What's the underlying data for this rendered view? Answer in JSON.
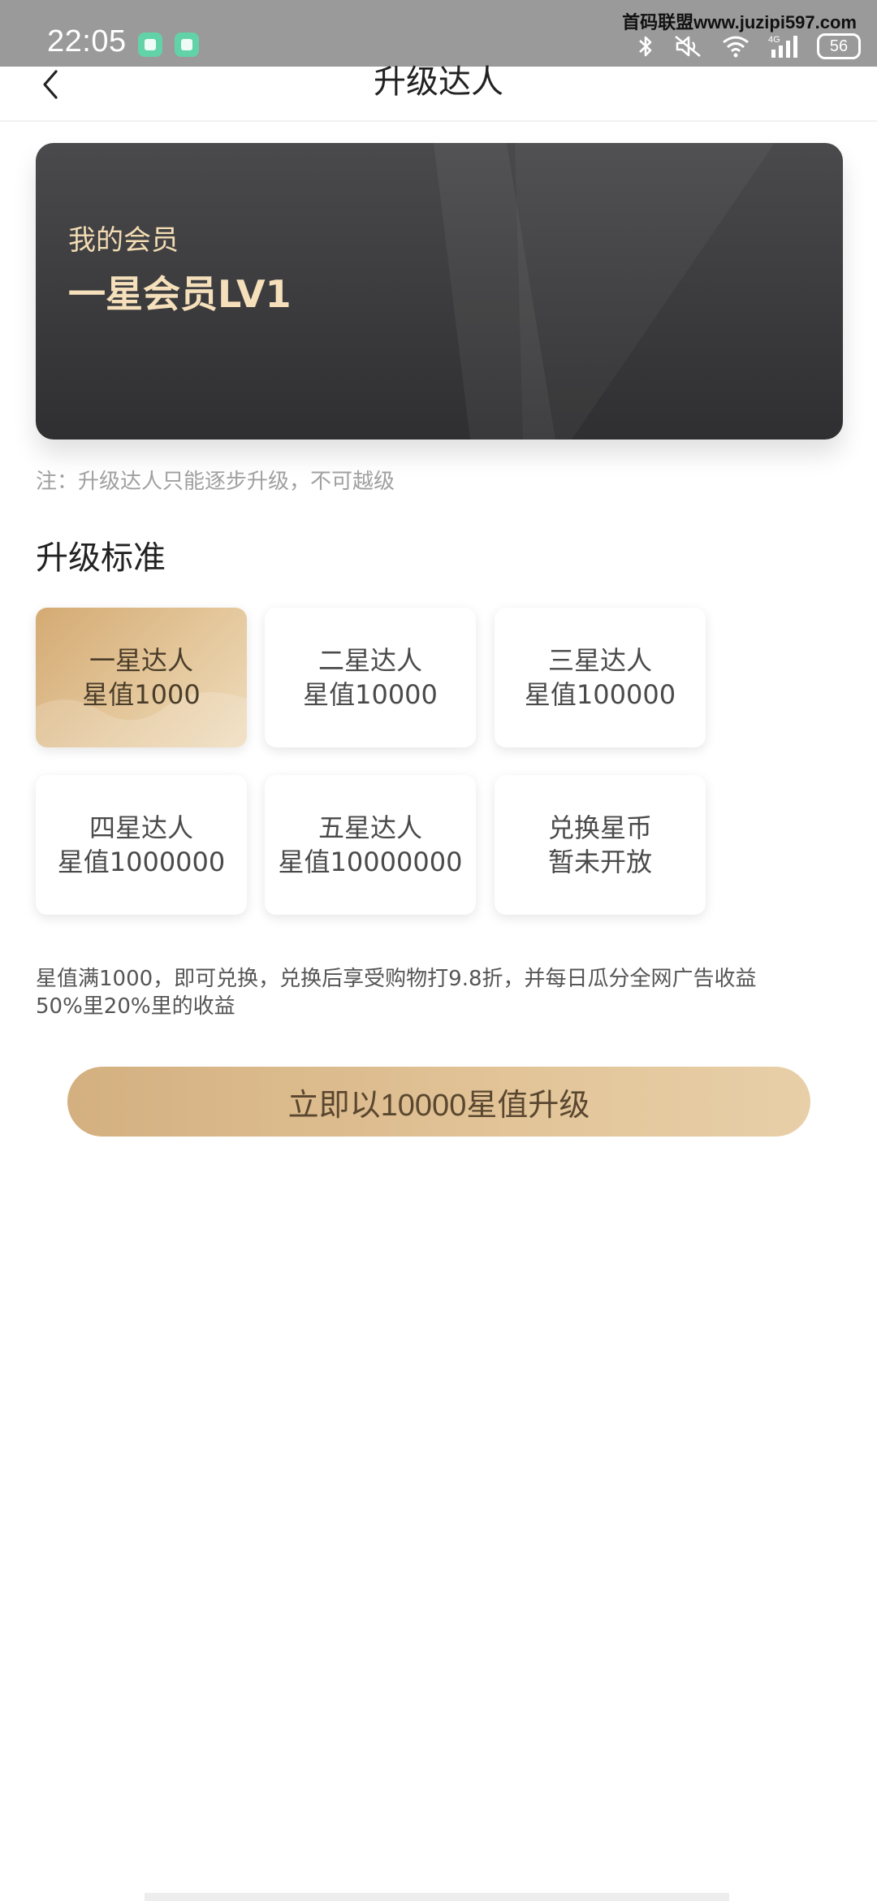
{
  "status_bar": {
    "time": "22:05",
    "watermark": "首码联盟www.juzipi597.com",
    "battery": "56",
    "network": "4G",
    "icons": [
      "shield-app-icon",
      "card-app-icon",
      "bluetooth-icon",
      "mute-icon",
      "wifi-icon",
      "signal-icon",
      "battery-icon"
    ]
  },
  "navbar": {
    "title": "升级达人",
    "back_icon": "chevron-left-icon"
  },
  "member_card": {
    "label": "我的会员",
    "level": "一星会员LV1",
    "text_color": "#f5e0bb"
  },
  "note": "注：升级达人只能逐步升级，不可越级",
  "section_title": "升级标准",
  "levels": [
    {
      "name": "一星达人",
      "value": "星值1000",
      "selected": true
    },
    {
      "name": "二星达人",
      "value": "星值10000",
      "selected": false
    },
    {
      "name": "三星达人",
      "value": "星值100000",
      "selected": false
    },
    {
      "name": "四星达人",
      "value": "星值1000000",
      "selected": false
    },
    {
      "name": "五星达人",
      "value": "星值10000000",
      "selected": false
    },
    {
      "name": "兑换星币",
      "value": "暂未开放",
      "selected": false
    }
  ],
  "description": "星值满1000，即可兑换，兑换后享受购物打9.8折，并每日瓜分全网广告收益50%里20%里的收益",
  "upgrade_button": "立即以10000星值升级",
  "colors": {
    "gold_accent": "#d4aa73",
    "card_dark": "#3a3a3c",
    "status_bar": "#9a9a9a"
  }
}
